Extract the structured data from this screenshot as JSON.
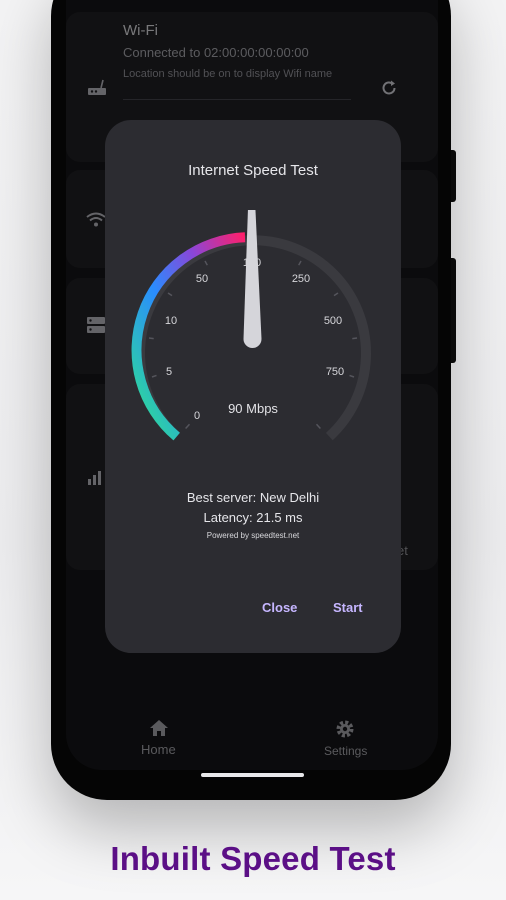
{
  "wifi": {
    "title": "Wi-Fi",
    "status": "Connected to 02:00:00:00:00:00",
    "note": "Location should be on to display Wifi name",
    "icons": [
      "router-icon",
      "refresh-icon"
    ]
  },
  "background_cards": {
    "icons": [
      "wifi-signal-icon",
      "server-icon",
      "bar-chart-icon"
    ],
    "partial_text": "et"
  },
  "dialog": {
    "title": "Internet Speed Test",
    "gauge": {
      "labels": [
        "0",
        "5",
        "10",
        "50",
        "100",
        "250",
        "500",
        "750"
      ],
      "reading": "90 Mbps",
      "colors": [
        "#2ee58a",
        "#2a8cff",
        "#8a46d8",
        "#ff1f6a"
      ]
    },
    "best_server": "Best server: New Delhi",
    "latency": "Latency: 21.5 ms",
    "powered_by": "Powered by speedtest.net",
    "close_label": "Close",
    "start_label": "Start"
  },
  "nav": {
    "home_label": "Home",
    "settings_label": "Settings"
  },
  "caption": "Inbuilt Speed Test"
}
